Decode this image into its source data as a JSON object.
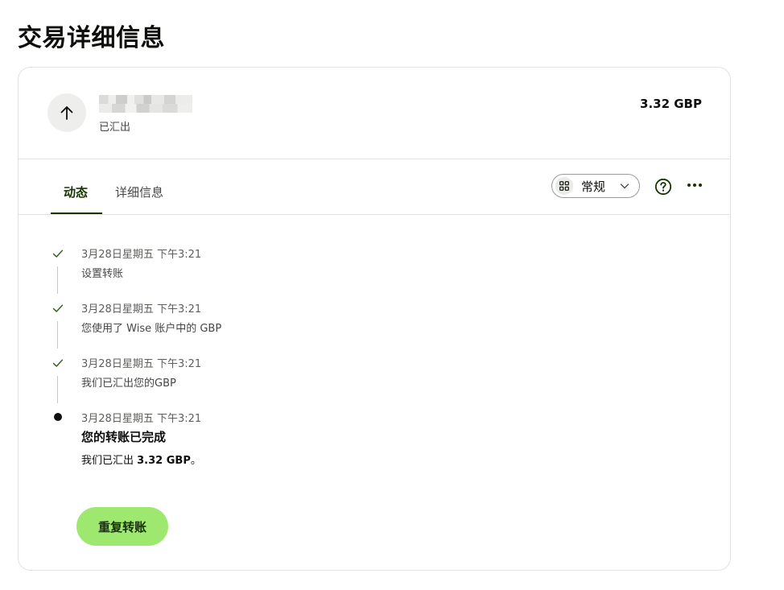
{
  "page": {
    "title": "交易详细信息"
  },
  "transaction": {
    "status": "已汇出",
    "amount": "3.32 GBP",
    "direction_icon": "arrow-up-icon"
  },
  "tabs": [
    {
      "label": "动态",
      "active": true
    },
    {
      "label": "详细信息",
      "active": false
    }
  ],
  "view_select": {
    "label": "常规",
    "icon": "grid-icon"
  },
  "timeline": [
    {
      "date": "3月28日星期五 下午3:21",
      "text": "设置转账",
      "state": "done"
    },
    {
      "date": "3月28日星期五 下午3:21",
      "text": "您使用了 Wise 账户中的 GBP",
      "state": "done"
    },
    {
      "date": "3月28日星期五 下午3:21",
      "text": "我们已汇出您的GBP",
      "state": "done"
    },
    {
      "date": "3月28日星期五 下午3:21",
      "title": "您的转账已完成",
      "sub_prefix": "我们已汇出 ",
      "sub_amount": "3.32 GBP",
      "sub_suffix": "。",
      "state": "current"
    }
  ],
  "actions": {
    "repeat_label": "重复转账"
  },
  "colors": {
    "accent": "#9fe870",
    "brand_dark": "#163300",
    "check": "#2f5711"
  }
}
